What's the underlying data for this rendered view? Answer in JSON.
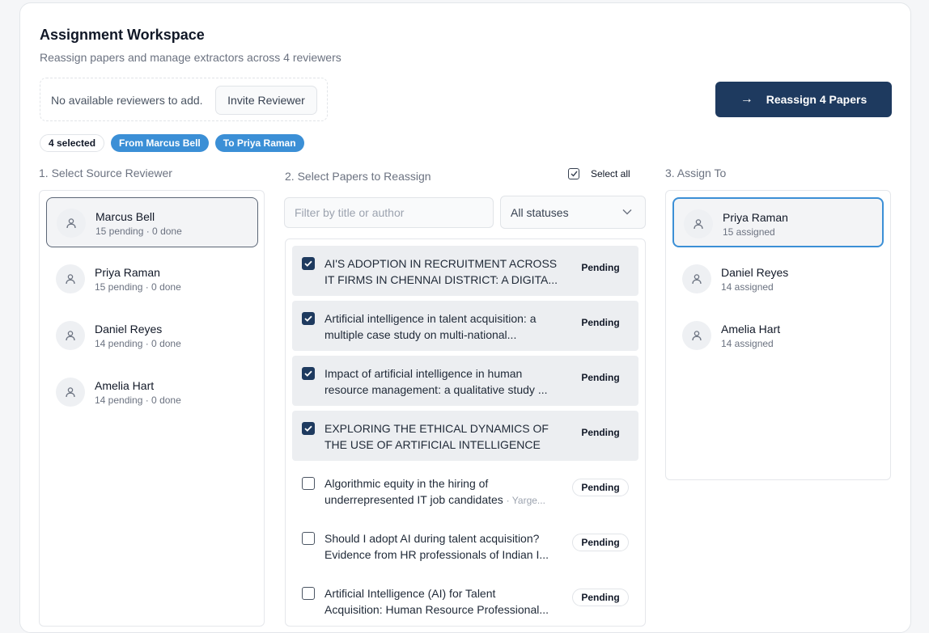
{
  "header": {
    "title": "Assignment Workspace",
    "subtitle": "Reassign papers and manage extractors across 4 reviewers"
  },
  "invite": {
    "message": "No available reviewers to add.",
    "button_label": "Invite Reviewer"
  },
  "reassign_button": {
    "label": "Reassign 4 Papers"
  },
  "chips": {
    "selected": "4 selected",
    "from": "From Marcus Bell",
    "to": "To Priya Raman"
  },
  "source": {
    "label": "1. Select Source Reviewer",
    "reviewers": [
      {
        "name": "Marcus Bell",
        "meta": "15 pending · 0 done",
        "selected": true
      },
      {
        "name": "Priya Raman",
        "meta": "15 pending · 0 done",
        "selected": false
      },
      {
        "name": "Daniel Reyes",
        "meta": "14 pending · 0 done",
        "selected": false
      },
      {
        "name": "Amelia Hart",
        "meta": "14 pending · 0 done",
        "selected": false
      }
    ]
  },
  "papers": {
    "label": "2. Select Papers to Reassign",
    "select_all_label": "Select all",
    "filter_placeholder": "Filter by title or author",
    "status_filter": "All statuses",
    "items": [
      {
        "line1": "AI'S ADOPTION IN RECRUITMENT ACROSS",
        "line2": "IT FIRMS IN CHENNAI DISTRICT: A DIGITA...",
        "author": "",
        "status": "Pending",
        "checked": true
      },
      {
        "line1": "Artificial intelligence in talent acquisition: a",
        "line2": "multiple case study on multi-national...",
        "author": "",
        "status": "Pending",
        "checked": true
      },
      {
        "line1": "Impact of artificial intelligence in human",
        "line2": "resource management: a qualitative study ...",
        "author": "",
        "status": "Pending",
        "checked": true
      },
      {
        "line1": "EXPLORING THE ETHICAL DYNAMICS OF",
        "line2": "THE USE OF ARTIFICIAL INTELLIGENCE (A...",
        "author": "",
        "status": "Pending",
        "checked": true
      },
      {
        "line1": "Algorithmic equity in the hiring of",
        "line2": "underrepresented IT job candidates",
        "author": "· Yarge...",
        "status": "Pending",
        "checked": false
      },
      {
        "line1": "Should I adopt AI during talent acquisition?",
        "line2": "Evidence from HR professionals of Indian I...",
        "author": "",
        "status": "Pending",
        "checked": false
      },
      {
        "line1": "Artificial Intelligence (AI) for Talent",
        "line2": "Acquisition: Human Resource Professional...",
        "author": "",
        "status": "Pending",
        "checked": false
      }
    ]
  },
  "assign": {
    "label": "3. Assign To",
    "reviewers": [
      {
        "name": "Priya Raman",
        "meta": "15 assigned",
        "selected": true
      },
      {
        "name": "Daniel Reyes",
        "meta": "14 assigned",
        "selected": false
      },
      {
        "name": "Amelia Hart",
        "meta": "14 assigned",
        "selected": false
      }
    ]
  },
  "colors": {
    "primary": "#1e3a5f",
    "accent_blue": "#3b8fd6"
  }
}
